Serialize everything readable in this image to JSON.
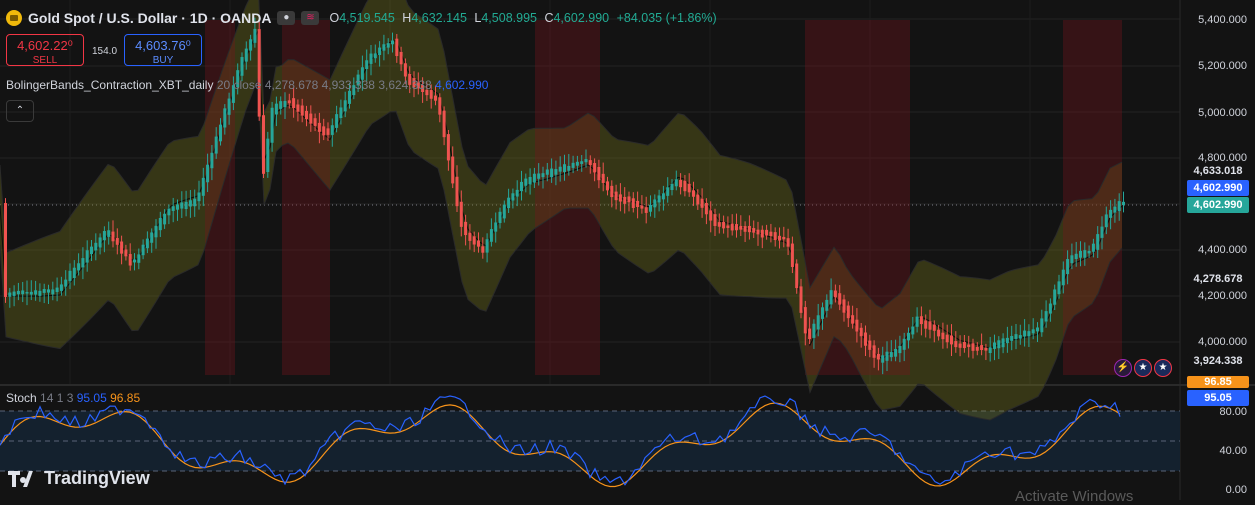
{
  "header": {
    "symbol_title": "Gold Spot / U.S. Dollar · 1D · OANDA",
    "ohlc": [
      {
        "k": "O",
        "v": "4,519.545"
      },
      {
        "k": "H",
        "v": "4,632.145"
      },
      {
        "k": "L",
        "v": "4,508.995"
      },
      {
        "k": "C",
        "v": "4,602.990"
      }
    ],
    "change": "+84.035 (+1.86%)"
  },
  "trade": {
    "sell_price": "4,602.22⁰",
    "sell_label": "SELL",
    "spread": "154.0",
    "buy_price": "4,603.76⁰",
    "buy_label": "BUY"
  },
  "indicator": {
    "name": "BolingerBands_Contraction_XBT_daily",
    "params": "20 close",
    "v1": "4,278.678",
    "v2": "4,933.338",
    "v3": "3,624.338",
    "v4": "4,602.990"
  },
  "stoch": {
    "label": "Stoch",
    "params": "14 1 3",
    "k": "95.05",
    "d": "96.85"
  },
  "price_axis": [
    "5,400.000",
    "5,200.000",
    "5,000.000",
    "4,800.000",
    "4,400.000",
    "4,200.000",
    "4,000.000"
  ],
  "stoch_axis": [
    "80.00",
    "40.00",
    "0.00"
  ],
  "tags": {
    "upper": "4,633.018",
    "price_blue": "4,602.990",
    "price_green": "4,602.990",
    "basis": "4,278.678",
    "lower": "3,924.338",
    "stoch_d": "96.85",
    "stoch_k": "95.05"
  },
  "colors": {
    "up": "#26a69a",
    "down": "#ef5350",
    "bg": "#131313"
  },
  "branding": {
    "logo_text": "TradingView"
  },
  "overlay": {
    "activate": "Activate Windows"
  }
}
